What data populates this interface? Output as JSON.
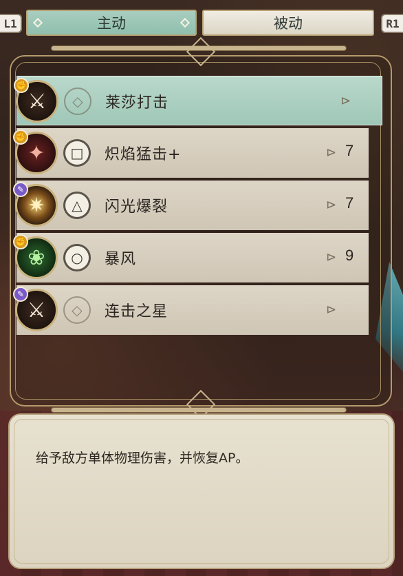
{
  "tabs": {
    "left_key": "L1",
    "right_key": "R1",
    "active_label": "主动",
    "inactive_label": "被动"
  },
  "skills": [
    {
      "name": "莱莎打击",
      "cost": "",
      "button": "",
      "type": "phys",
      "icon": "staff-strike-icon",
      "selected": true
    },
    {
      "name": "炽焰猛击+",
      "cost": "7",
      "button": "□",
      "type": "phys",
      "icon": "flame-staff-icon",
      "selected": false
    },
    {
      "name": "闪光爆裂",
      "cost": "7",
      "button": "△",
      "type": "mag",
      "icon": "flash-burst-icon",
      "selected": false
    },
    {
      "name": "暴风",
      "cost": "9",
      "button": "○",
      "type": "phys",
      "icon": "storm-icon",
      "selected": false
    },
    {
      "name": "连击之星",
      "cost": "",
      "button": "",
      "type": "mag",
      "icon": "staff-strike-icon",
      "selected": false
    }
  ],
  "description": "给予敌方单体物理伤害，并恢复AP。",
  "colors": {
    "selected_row": "#a9cfc0",
    "row": "#d8d0c0",
    "frame_gold": "#b59a6c",
    "physical_badge": "#d89a1e",
    "magic_badge": "#7a5ac8"
  }
}
